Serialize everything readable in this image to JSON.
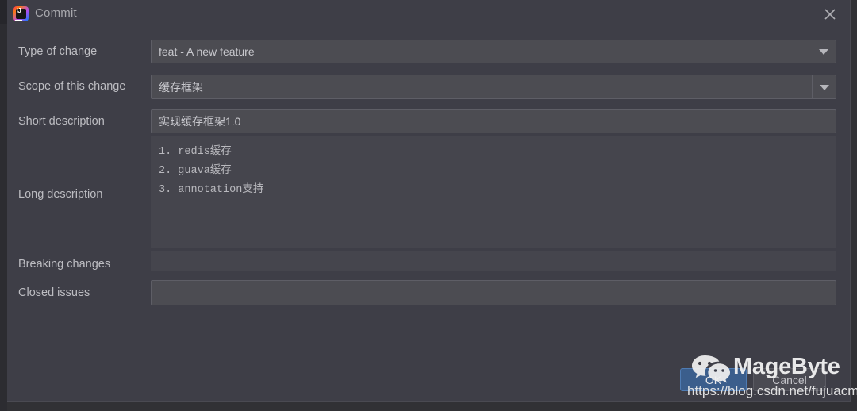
{
  "window": {
    "title": "Commit",
    "app_icon": "intellij-idea-icon",
    "icon_letters": "IJ",
    "close_icon": "close-icon"
  },
  "form": {
    "rows": [
      {
        "label": "Type of change",
        "control": "combobox",
        "value": "feat - A new feature",
        "icon": "chevron-down-icon"
      },
      {
        "label": "Scope of this change",
        "control": "editable-combobox",
        "value": "缓存框架",
        "icon": "chevron-down-icon"
      },
      {
        "label": "Short description",
        "control": "textfield",
        "value": "实现缓存框架1.0"
      },
      {
        "label": "Long description",
        "control": "textarea",
        "value": ""
      },
      {
        "label": "Breaking changes",
        "control": "textfield",
        "value": ""
      },
      {
        "label": "Closed issues",
        "control": "textfield",
        "value": ""
      }
    ],
    "long_description_lines": [
      "1. redis缓存",
      "2. guava缓存",
      "3. annotation支持"
    ]
  },
  "footer": {
    "ok_label": "OK",
    "cancel_label": "Cancel"
  },
  "watermark": {
    "brand": "MageByte",
    "url": "https://blog.csdn.net/fujuacm",
    "logo_icon": "wechat-icon"
  },
  "colors": {
    "dialog_background": "#3e3e47",
    "field_background": "#4c4c52",
    "field_border": "#5e5e66",
    "label_text": "#bdbdc2",
    "value_text": "#c8c8cd",
    "primary_button": "#3b5e8c"
  }
}
